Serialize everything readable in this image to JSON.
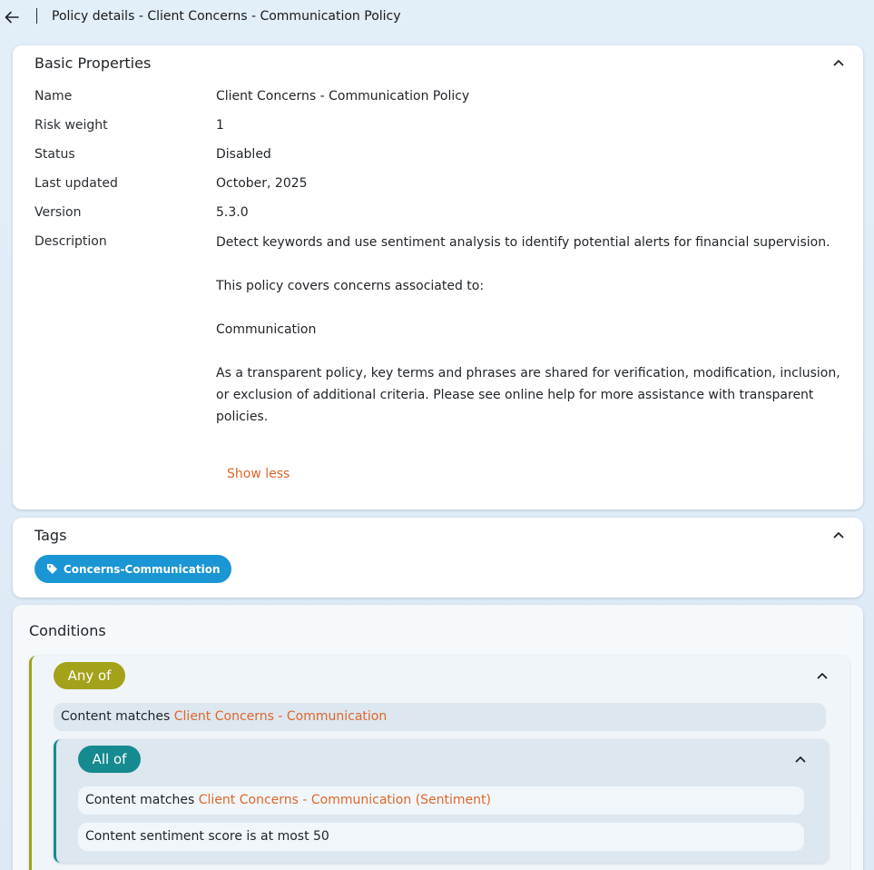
{
  "header": {
    "title": "Policy details - Client Concerns - Communication Policy"
  },
  "basic_properties": {
    "title": "Basic Properties",
    "rows": [
      {
        "label": "Name",
        "value": "Client Concerns - Communication Policy"
      },
      {
        "label": "Risk weight",
        "value": "1"
      },
      {
        "label": "Status",
        "value": "Disabled"
      },
      {
        "label": "Last updated",
        "value": "October, 2025"
      },
      {
        "label": "Version",
        "value": "5.3.0"
      }
    ],
    "description_label": "Description",
    "description_paragraphs": [
      "Detect keywords and use sentiment analysis to identify potential alerts for financial supervision.",
      "This policy covers concerns associated to:",
      "Communication",
      "As a transparent policy, key terms and phrases are shared for verification, modification, inclusion, or exclusion of additional criteria. Please see online help for more assistance with transparent policies."
    ],
    "show_less_label": "Show less"
  },
  "tags": {
    "title": "Tags",
    "items": [
      "Concerns-Communication"
    ]
  },
  "conditions": {
    "title": "Conditions",
    "any_group": {
      "label": "Any of",
      "row": {
        "prefix": "Content matches",
        "link": "Client Concerns - Communication"
      },
      "all_group": {
        "label": "All of",
        "rows": [
          {
            "prefix": "Content matches",
            "link": "Client Concerns - Communication (Sentiment)"
          },
          {
            "text": "Content sentiment score is at most 50"
          }
        ]
      }
    }
  },
  "colors": {
    "accent_orange": "#e0662a",
    "tag_blue": "#1a96d4",
    "any_of_olive": "#a3a21a",
    "all_of_teal": "#158a8f"
  },
  "icons": {
    "back": "arrow-left-icon",
    "collapse": "chevron-up-icon",
    "tag": "tag-icon"
  }
}
